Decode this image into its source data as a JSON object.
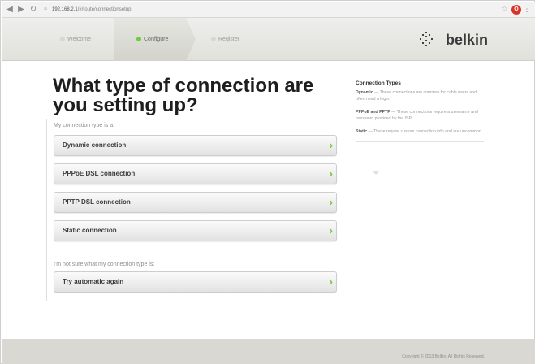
{
  "browser": {
    "address_host": "192.168.2.1",
    "address_path": "/#/route/connectionsetup",
    "icons": [
      "back-icon",
      "forward-icon",
      "reload-icon",
      "page-icon",
      "star-icon",
      "extension-icon",
      "menu-icon"
    ]
  },
  "header": {
    "steps": [
      {
        "label": "Welcome",
        "state": "inactive"
      },
      {
        "label": "Configure",
        "state": "active"
      },
      {
        "label": "Register",
        "state": "inactive"
      }
    ],
    "logo_text": "belkin"
  },
  "main": {
    "title": "What type of connection are you setting up?",
    "prompt": "My connection type is a:",
    "options": [
      {
        "label": "Dynamic connection"
      },
      {
        "label": "PPPoE DSL connection"
      },
      {
        "label": "PPTP DSL connection"
      },
      {
        "label": "Static connection"
      }
    ],
    "unsure_prompt": "I'm not sure what my connection type is:",
    "auto_option": {
      "label": "Try automatic again"
    }
  },
  "sidebar": {
    "title": "Connection Types",
    "items": [
      {
        "term": "Dynamic",
        "text": "— These connections are common for cable users and often need a login."
      },
      {
        "term": "PPPoE and PPTP",
        "text": "— These connections require a username and password provided by the ISP."
      },
      {
        "term": "Static",
        "text": "— These require custom connection info and are uncommon."
      }
    ]
  },
  "footer": {
    "copyright": "Copyright © 2013 Belkin. All Rights Reserved."
  },
  "colors": {
    "accent_green": "#7ccd3e",
    "header_bg": "#e8e8e3",
    "footer_bg": "#d9d8d2"
  }
}
